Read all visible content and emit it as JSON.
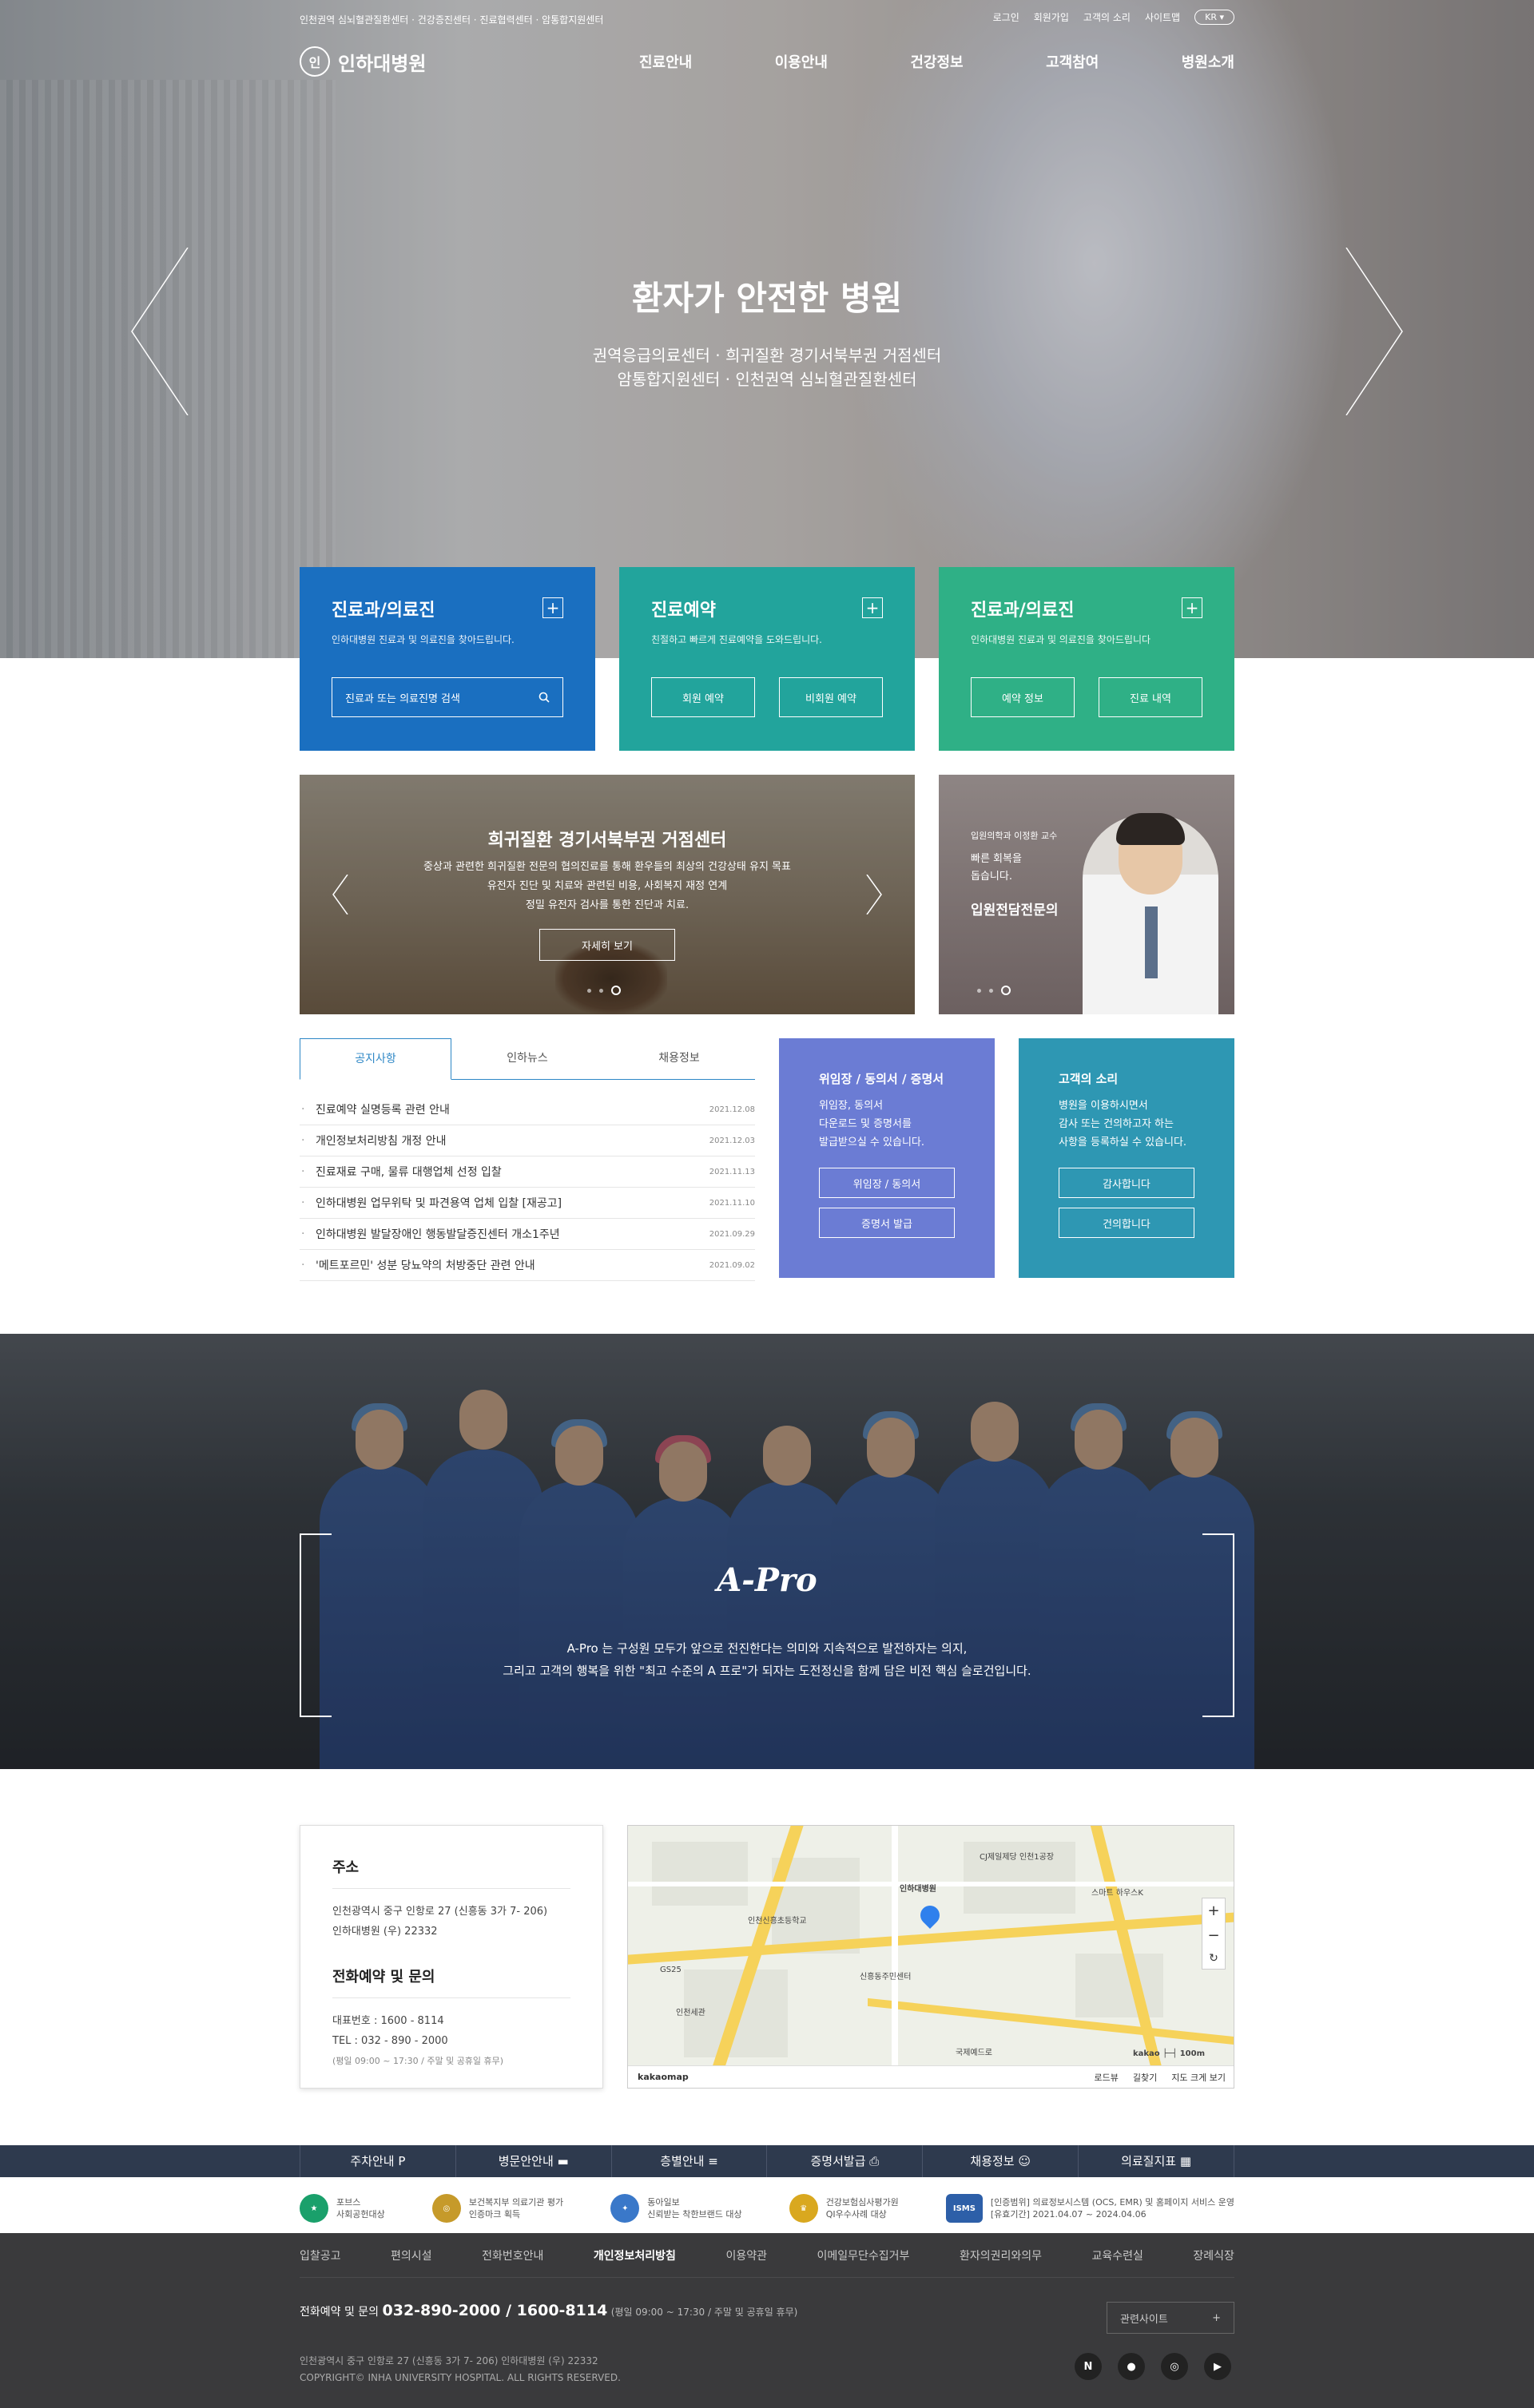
{
  "topbar": {
    "left_links": "인천권역 심뇌혈관질환센터 · 건강증진센터 · 진료협력센터 · 암통합지원센터",
    "right_links": [
      "로그인",
      "회원가입",
      "고객의 소리",
      "사이트맵"
    ],
    "lang": "KR"
  },
  "logo": {
    "mark": "인",
    "name": "인하대병원"
  },
  "gnb": [
    "진료안내",
    "이용안내",
    "건강정보",
    "고객참여",
    "병원소개"
  ],
  "hero": {
    "title": "환자가 안전한 병원",
    "sub1": "권역응급의료센터 · 희귀질환 경기서북부권 거점센터",
    "sub2": "암통합지원센터 · 인천권역 심뇌혈관질환센터"
  },
  "cards": [
    {
      "title": "진료과/의료진",
      "desc": "인하대병원 진료과 및 의료진을 찾아드립니다.",
      "search_placeholder": "진료과 또는 의료진명 검색",
      "color": "#1a6fc0"
    },
    {
      "title": "진료예약",
      "desc": "친절하고 빠르게 진료예약을 도와드립니다.",
      "btn1": "회원 예약",
      "btn2": "비회원 예약",
      "color": "#22a49c"
    },
    {
      "title": "진료과/의료진",
      "desc": "인하대병원 진료과 및 의료진을 찾아드립니다",
      "btn1": "예약 정보",
      "btn2": "진료 내역",
      "color": "#2fb086"
    }
  ],
  "promo": {
    "title": "희귀질환 경기서북부권 거점센터",
    "desc1": "중상과 관련한 희귀질환 전문의 협의진료를 통해 환우들의 최상의 건강상태 유지 목표",
    "desc2": "유전자 진단 및 치료와 관련된 비용, 사회복지 재정 연계",
    "desc3": "정밀 유전자 검사를 통한 진단과 치료.",
    "button": "자세히 보기"
  },
  "doctor": {
    "role": "입원의학과 이정환 교수",
    "line1": "빠른 회복을",
    "line2": "돕습니다.",
    "title": "입원전담전문의"
  },
  "tabs": [
    "공지사항",
    "인하뉴스",
    "채용정보"
  ],
  "news": [
    {
      "title": "진료예약 실명등록 관련 안내",
      "date": "2021.12.08"
    },
    {
      "title": "개인정보처리방침 개정 안내",
      "date": "2021.12.03"
    },
    {
      "title": "진료재료 구매, 물류 대행업체 선정 입찰",
      "date": "2021.11.13"
    },
    {
      "title": "인하대병원 업무위탁 및 파견용역 업체 입찰 [재공고]",
      "date": "2021.11.10"
    },
    {
      "title": "인하대병원 발달장애인 행동발달증진센터 개소1주년",
      "date": "2021.09.29"
    },
    {
      "title": "'메트포르민' 성분 당뇨약의 처방중단 관련 안내",
      "date": "2021.09.02"
    }
  ],
  "doc_card": {
    "title": "위임장 / 동의서 / 증명서",
    "desc1": "위임장, 동의서",
    "desc2": "다운로드 및 증명서를",
    "desc3": "발급받으실 수 있습니다.",
    "btn1": "위임장 / 동의서",
    "btn2": "증명서 발급",
    "color": "#6b7cd4"
  },
  "voice_card": {
    "title": "고객의 소리",
    "desc1": "병원을 이용하시면서",
    "desc2": "감사 또는 건의하고자 하는",
    "desc3": "사항을 등록하실 수 있습니다.",
    "btn1": "감사합니다",
    "btn2": "건의합니다",
    "color": "#2e97b3"
  },
  "apro": {
    "logo": "A-Pro",
    "line1": "A-Pro 는 구성원 모두가 앞으로 전진한다는 의미와 지속적으로 발전하자는 의지,",
    "line2": "그리고 고객의 행복을 위한 \"최고 수준의 A 프로\"가 되자는 도전정신을 함께 담은 비전 핵심 슬로건입니다."
  },
  "address": {
    "heading": "주소",
    "line1": "인천광역시 중구 인항로 27 (신흥동 3가 7- 206)",
    "line2": "인하대병원 (우) 22332",
    "phone_heading": "전화예약 및 문의",
    "rep": "대표번호 : 1600 - 8114",
    "tel": "TEL : 032 - 890 - 2000",
    "hours": "(평일 09:00 ~ 17:30 / 주말 및 공휴일 휴무)"
  },
  "map": {
    "brand": "kakaomap",
    "links": [
      "로드뷰",
      "길찾기",
      "지도 크게 보기"
    ],
    "labels": [
      "인하대병원",
      "인천신흥초등학교",
      "CJ제일제당 인천1공장",
      "인천세관",
      "신흥동주민센터",
      "스마트 하우스K",
      "GS25",
      "국제예드로"
    ],
    "scale": "100m",
    "brand_small": "kakao"
  },
  "quick": [
    "주차안내 P",
    "병문안안내",
    "층별안내",
    "증명서발급",
    "채용정보",
    "의료질지표"
  ],
  "certs": [
    {
      "l1": "포브스",
      "l2": "사회공헌대상",
      "color": "#1aa06b"
    },
    {
      "l1": "보건복지부 의료기관 평가",
      "l2": "인증마크 획득",
      "color": "#c69a2a"
    },
    {
      "l1": "동아일보",
      "l2": "신뢰받는 착한브랜드 대상",
      "color": "#3a78c9"
    },
    {
      "l1": "건강보험심사평가원",
      "l2": "QI우수사례 대상",
      "color": "#d9a81f"
    },
    {
      "l1": "[인증범위] 의료정보시스템 (OCS, EMR) 및 홈페이지 서비스 운영",
      "l2": "[유효기간] 2021.04.07 ~ 2024.04.06",
      "color": "#2d5fa8",
      "badge": "ISMS"
    }
  ],
  "footer": {
    "nav": [
      "입찰공고",
      "편의시설",
      "전화번호안내",
      "개인정보처리방침",
      "이용약관",
      "이메일무단수집거부",
      "환자의권리와의무",
      "교육수련실",
      "장례식장"
    ],
    "phone_label": "전화예약 및 문의",
    "phone": "032-890-2000 / 1600-8114",
    "phone_hours": "(평일 09:00 ~ 17:30 / 주말 및 공휴일 휴무)",
    "addr": "인천광역시 중구 인항로 27 (신흥동 3가 7- 206) 인하대병원 (우) 22332",
    "copyright": "COPYRIGHT© INHA UNIVERSITY HOSPITAL. ALL RIGHTS RESERVED.",
    "related": "관련사이트",
    "sns": [
      "N",
      "●",
      "◎",
      "▶"
    ]
  }
}
